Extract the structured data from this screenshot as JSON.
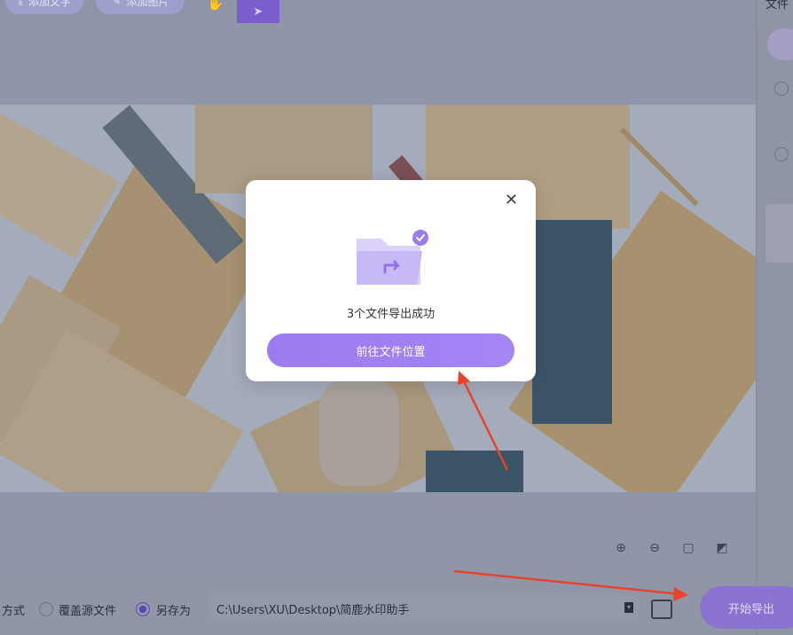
{
  "toolbar": {
    "add_text_label": "添加文字",
    "add_image_label": "添加图片"
  },
  "right_panel": {
    "title": "文件"
  },
  "dialog": {
    "message": "3个文件导出成功",
    "goto_button": "前往文件位置",
    "close_glyph": "✕"
  },
  "export_settings": {
    "mode_label": "方式",
    "overwrite_label": "覆盖源文件",
    "save_as_label": "另存为",
    "selected": "save_as",
    "path_value": "C:\\Users\\XU\\Desktop\\简鹿水印助手"
  },
  "actions": {
    "start_export_label": "开始导出"
  },
  "zoom_tools": [
    "zoom-in-icon",
    "zoom-out-icon",
    "fit-icon",
    "reset-icon"
  ],
  "colors": {
    "accent": "#9c7bee",
    "arrow": "#e8432b"
  }
}
